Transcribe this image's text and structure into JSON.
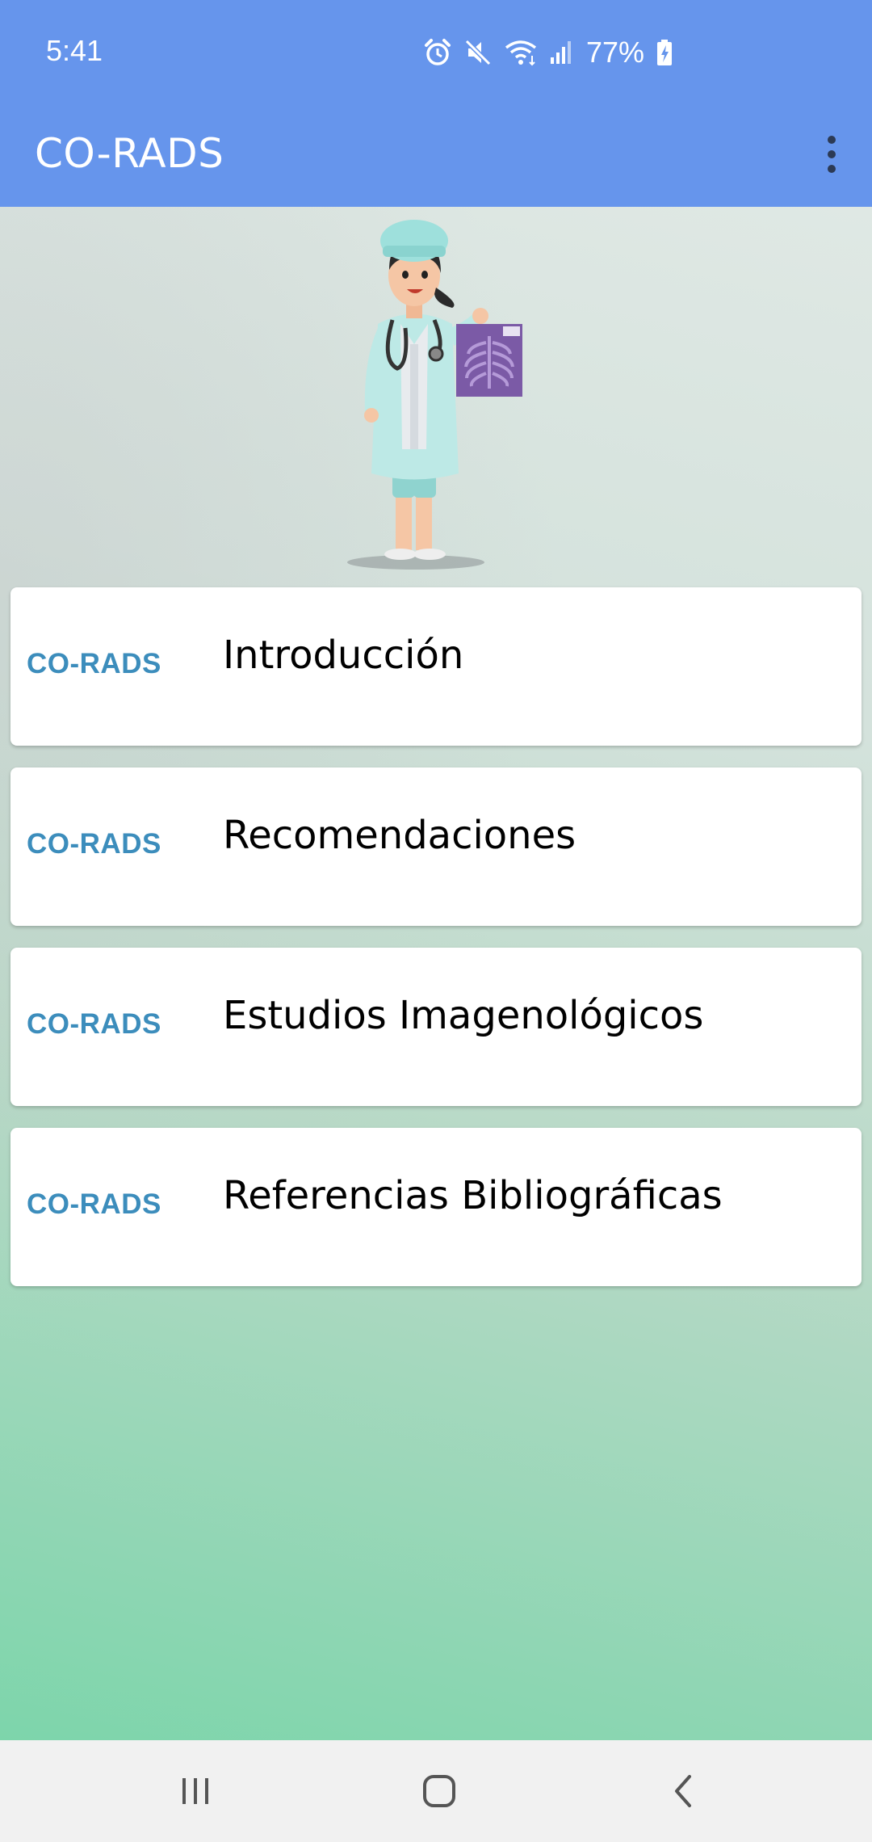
{
  "status_bar": {
    "time": "5:41",
    "battery": "77%",
    "icons": [
      "alarm-icon",
      "mute-icon",
      "wifi-icon",
      "signal-icon",
      "battery-charging-icon"
    ]
  },
  "app_bar": {
    "title": "CO-RADS",
    "menu_icon": "more-vert-icon"
  },
  "menu": [
    {
      "badge": "CO-RADS",
      "label": "Introducción"
    },
    {
      "badge": "CO-RADS",
      "label": "Recomendaciones"
    },
    {
      "badge": "CO-RADS",
      "label": "Estudios Imagenológicos"
    },
    {
      "badge": "CO-RADS",
      "label": "Referencias Bibliográficas"
    }
  ],
  "nav_bar": {
    "buttons": [
      "recent-apps-icon",
      "home-icon",
      "back-icon"
    ]
  },
  "colors": {
    "primary": "#6695ec",
    "badge": "#3c8dbc",
    "gradient_bottom": "#7dd5ab"
  }
}
